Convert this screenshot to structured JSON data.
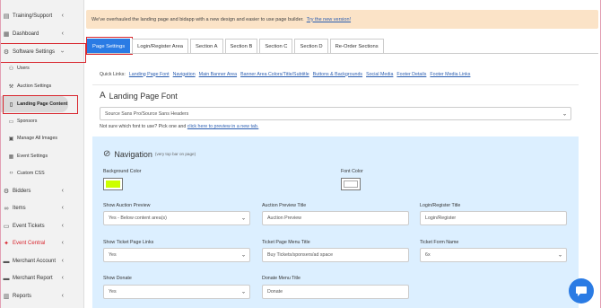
{
  "sidebar": {
    "items": [
      {
        "label": "Training/Support"
      },
      {
        "label": "Dashboard"
      },
      {
        "label": "Software Settings"
      },
      {
        "label": "Users"
      },
      {
        "label": "Auction Settings"
      },
      {
        "label": "Landing Page Content"
      },
      {
        "label": "Sponsors"
      },
      {
        "label": "Manage All Images"
      },
      {
        "label": "Event Settings"
      },
      {
        "label": "Custom CSS"
      },
      {
        "label": "Bidders"
      },
      {
        "label": "Items"
      },
      {
        "label": "Event Tickets"
      },
      {
        "label": "Event Central"
      },
      {
        "label": "Merchant Account"
      },
      {
        "label": "Merchant Report"
      },
      {
        "label": "Reports"
      }
    ]
  },
  "banner": {
    "text": "We've overhauled the landing page and bidapp with a new design and easier to use page builder.",
    "link": "Try the new version!"
  },
  "tabs": [
    {
      "label": "Page Settings"
    },
    {
      "label": "Login/Register Area"
    },
    {
      "label": "Section A"
    },
    {
      "label": "Section B"
    },
    {
      "label": "Section C"
    },
    {
      "label": "Section D"
    },
    {
      "label": "Re-Order Sections"
    }
  ],
  "quicklinks": {
    "label": "Quick Links:",
    "links": [
      {
        "label": "Landing Page Font"
      },
      {
        "label": "Navigation"
      },
      {
        "label": "Main Banner Area"
      },
      {
        "label": "Banner Area Colors/Title/Subtitle"
      },
      {
        "label": "Buttons & Backgrounds"
      },
      {
        "label": "Social Media"
      },
      {
        "label": "Footer Details"
      },
      {
        "label": "Footer Media Links"
      }
    ]
  },
  "font_section": {
    "title": "Landing Page Font",
    "select_value": "Source Sans Pro/Source Sans Headers",
    "hint_prefix": "Not sure which font to use? Pick one and",
    "hint_link": "click here to preview in a new tab."
  },
  "navigation": {
    "title": "Navigation",
    "subtitle": "(very top bar on page)",
    "bg_color_label": "Background Color",
    "bg_color": "#ccff00",
    "font_color_label": "Font Color",
    "font_color": "#ffffff",
    "show_auction_preview_label": "Show Auction Preview",
    "show_auction_preview_value": "Yes - Below content area(s)",
    "auction_preview_title_label": "Auction Preview Title",
    "auction_preview_title_value": "Auction Preview",
    "login_register_title_label": "Login/Register Title",
    "login_register_title_value": "Login/Register",
    "show_ticket_links_label": "Show Ticket Page Links",
    "show_ticket_links_value": "Yes",
    "ticket_menu_title_label": "Ticket Page Menu Title",
    "ticket_menu_title_value": "Buy Tickets/sponsers/ad space",
    "ticket_form_name_label": "Ticket Form Name",
    "ticket_form_name_value": "6x",
    "show_donate_label": "Show Donate",
    "show_donate_value": "Yes",
    "donate_menu_title_label": "Donate Menu Title",
    "donate_menu_title_value": "Donate"
  },
  "colors": {
    "accent": "#2a7be4",
    "banner_bg": "#fbe3c7",
    "panel_bg": "#dcefff",
    "highlight_border": "#d8262e"
  }
}
